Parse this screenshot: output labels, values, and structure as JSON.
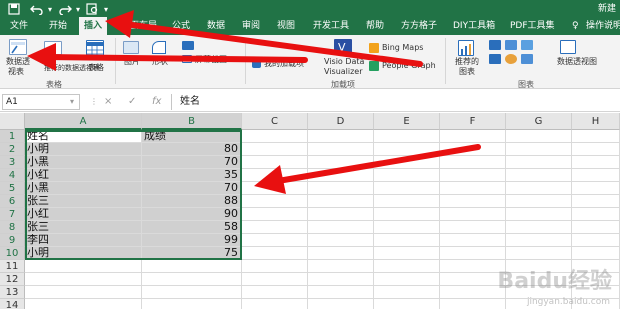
{
  "title_bar": {
    "doc_title": "新建"
  },
  "quick_access": {
    "save_icon": "save-icon",
    "undo_icon": "undo-icon",
    "redo_icon": "redo-icon",
    "print_preview_icon": "print-preview-icon"
  },
  "tabs": [
    {
      "label": "文件"
    },
    {
      "label": "开始"
    },
    {
      "label": "插入"
    },
    {
      "label": "页面布局"
    },
    {
      "label": "公式"
    },
    {
      "label": "数据"
    },
    {
      "label": "审阅"
    },
    {
      "label": "视图"
    },
    {
      "label": "开发工具"
    },
    {
      "label": "帮助"
    },
    {
      "label": "方方格子"
    },
    {
      "label": "DIY工具箱"
    },
    {
      "label": "PDF工具集"
    },
    {
      "label": "操作说明"
    }
  ],
  "active_tab": "插入",
  "ribbon": {
    "pivot_label1": "数据透",
    "pivot_label2": "视表",
    "recommended_pivot": "推荐的数据透视表",
    "table_label": "表格",
    "group_tables": "表格",
    "pictures": "图片",
    "shapes": "形状",
    "screenshot": "屏幕截图",
    "my_addins": "我的加载项",
    "visio_line1": "Visio Data",
    "visio_line2": "Visualizer",
    "bing_maps": "Bing Maps",
    "people_graph": "People Graph",
    "group_addins": "加载项",
    "recommended_charts1": "推荐的",
    "recommended_charts2": "图表",
    "pivot_chart": "数据透视图",
    "group_charts": "图表"
  },
  "formula_bar": {
    "name_box": "A1",
    "cancel": "×",
    "confirm": "✓",
    "fx": "fx",
    "value": "姓名"
  },
  "columns": [
    "A",
    "B",
    "C",
    "D",
    "E",
    "F",
    "G",
    "H"
  ],
  "rows": [
    "1",
    "2",
    "3",
    "4",
    "5",
    "6",
    "7",
    "8",
    "9",
    "10",
    "11",
    "12",
    "13",
    "14"
  ],
  "table": {
    "headers": [
      "姓名",
      "成绩"
    ],
    "data": [
      {
        "name": "小明",
        "score": "80"
      },
      {
        "name": "小黑",
        "score": "70"
      },
      {
        "name": "小红",
        "score": "35"
      },
      {
        "name": "小黑",
        "score": "70"
      },
      {
        "name": "张三",
        "score": "88"
      },
      {
        "name": "小红",
        "score": "90"
      },
      {
        "name": "张三",
        "score": "58"
      },
      {
        "name": "李四",
        "score": "99"
      },
      {
        "name": "小明",
        "score": "75"
      }
    ]
  },
  "colors": {
    "excel_green": "#217346",
    "arrow_red": "#e81010",
    "selection_fill": "#d0d0d0"
  },
  "watermark": {
    "text": "Baidu经验",
    "sub": "jingyan.baidu.com"
  }
}
